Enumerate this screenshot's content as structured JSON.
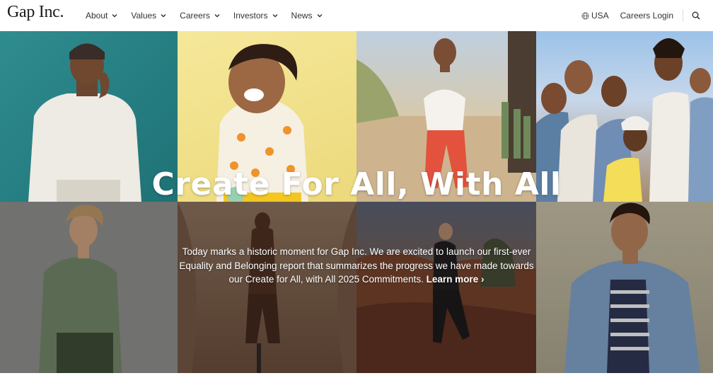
{
  "header": {
    "logo": "Gap Inc.",
    "nav": [
      {
        "label": "About"
      },
      {
        "label": "Values"
      },
      {
        "label": "Careers"
      },
      {
        "label": "Investors"
      },
      {
        "label": "News"
      }
    ],
    "region": "USA",
    "careers_login": "Careers Login",
    "icons": [
      "chevron-down-icon",
      "globe-icon",
      "search-icon"
    ]
  },
  "hero": {
    "headline": "Create For All, With All",
    "body": "Today marks a historic moment for Gap Inc. We are excited to launch our first-ever Equality and Belonging report that summarizes the progress we have made towards our Create for All, with All 2025 Commitments.",
    "cta": "Learn more ›"
  }
}
